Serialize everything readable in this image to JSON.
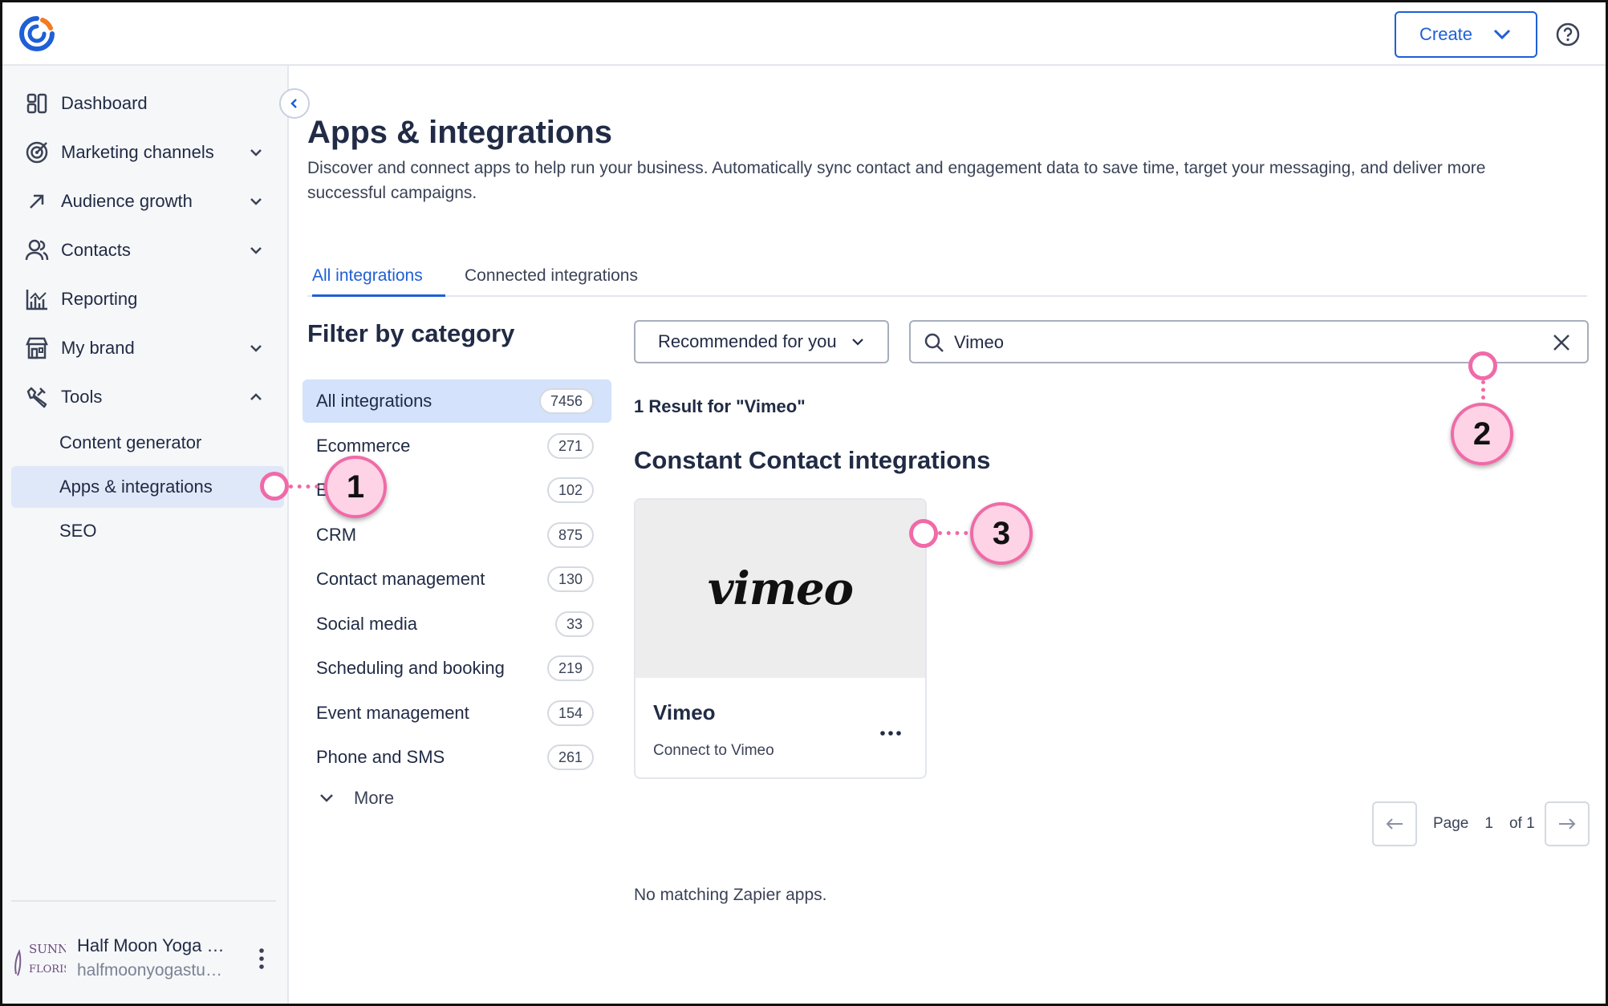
{
  "header": {
    "logo": "constant-contact-logo",
    "create_label": "Create",
    "help_icon": "help-circle-icon"
  },
  "sidebar": {
    "items": [
      {
        "label": "Dashboard",
        "icon": "dashboard-icon"
      },
      {
        "label": "Marketing channels",
        "icon": "target-icon"
      },
      {
        "label": "Audience growth",
        "icon": "arrow-up-right-icon"
      },
      {
        "label": "Contacts",
        "icon": "people-icon"
      },
      {
        "label": "Reporting",
        "icon": "chart-icon"
      },
      {
        "label": "My brand",
        "icon": "store-icon"
      },
      {
        "label": "Tools",
        "icon": "wrench-icon"
      }
    ],
    "sub_items": [
      "Content generator",
      "Apps & integrations",
      "SEO"
    ],
    "account": {
      "name": "Half Moon Yoga …",
      "email": "halfmoonyogastu…",
      "logo_text": "SUNNY'S FLORIST"
    }
  },
  "main": {
    "title": "Apps & integrations",
    "description": "Discover and connect apps to help run your business. Automatically sync contact and engagement data to save time, target your messaging, and deliver more successful campaigns.",
    "tabs": [
      "All integrations",
      "Connected integrations"
    ],
    "filter_title": "Filter by category",
    "categories": [
      {
        "label": "All integrations",
        "count": "7456"
      },
      {
        "label": "Ecommerce",
        "count": "271"
      },
      {
        "label": "E",
        "count": "102"
      },
      {
        "label": "CRM",
        "count": "875"
      },
      {
        "label": "Contact management",
        "count": "130"
      },
      {
        "label": "Social media",
        "count": "33"
      },
      {
        "label": "Scheduling and booking",
        "count": "219"
      },
      {
        "label": "Event management",
        "count": "154"
      },
      {
        "label": "Phone and SMS",
        "count": "261"
      }
    ],
    "more_label": "More",
    "sort_label": "Recommended for you",
    "search_value": "Vimeo",
    "result_count": "1 Result for \"Vimeo\"",
    "section_title": "Constant Contact integrations",
    "card": {
      "logo_text": "vimeo",
      "name": "Vimeo",
      "action": "Connect to Vimeo"
    },
    "pager": {
      "page_label": "Page",
      "page": "1",
      "of": "of 1"
    },
    "no_match": "No matching Zapier apps."
  },
  "callouts": [
    "1",
    "2",
    "3"
  ],
  "colors": {
    "accent": "#1f5fd6",
    "callout_fill": "#fdd3e5",
    "callout_border": "#f06aa8",
    "active_bg": "#d4e2fb"
  }
}
